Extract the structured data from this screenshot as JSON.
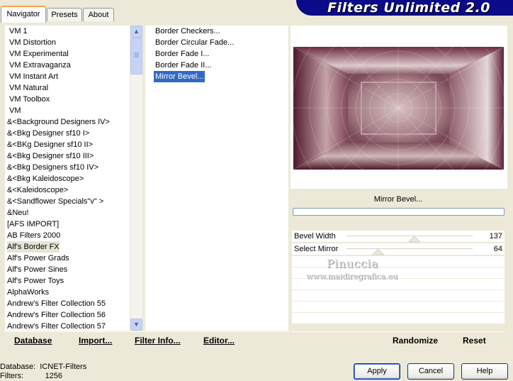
{
  "app": {
    "title": "Filters Unlimited 2.0"
  },
  "tabs": [
    {
      "label": "Navigator",
      "active": true
    },
    {
      "label": "Presets",
      "active": false
    },
    {
      "label": "About",
      "active": false
    }
  ],
  "categories": [
    "VM 1",
    "VM Distortion",
    "VM Experimental",
    "VM Extravaganza",
    "VM Instant Art",
    "VM Natural",
    "VM Toolbox",
    "VM",
    "&<Background Designers IV>",
    "&<Bkg Designer sf10 I>",
    "&<BKg Designer sf10 II>",
    "&<Bkg Designer sf10 III>",
    "&<Bkg Designers sf10 IV>",
    "&<Bkg Kaleidoscope>",
    "&<Kaleidoscope>",
    "&<Sandflower Specials\"v\" >",
    "&Neu!",
    "[AFS IMPORT]",
    "AB Filters 2000",
    "Alf's Border FX",
    "Alf's Power Grads",
    "Alf's Power Sines",
    "Alf's Power Toys",
    "AlphaWorks",
    "Andrew's Filter Collection 55",
    "Andrew's Filter Collection 56",
    "Andrew's Filter Collection 57"
  ],
  "selected_category": "Alf's Border FX",
  "filters": [
    "Border Checkers...",
    "Border Circular Fade...",
    "Border Fade I...",
    "Border Fade II...",
    "Mirror Bevel..."
  ],
  "selected_filter": "Mirror Bevel...",
  "preview": {
    "filter_name": "Mirror Bevel...",
    "colors": {
      "dark": "#5a1f30",
      "light": "#e8dcd8",
      "mid": "#a07a82"
    }
  },
  "params": [
    {
      "label": "Bevel Width",
      "value": "137",
      "level": 0.537
    },
    {
      "label": "Select Mirror",
      "value": "64",
      "level": 0.251
    }
  ],
  "watermark": {
    "name": "Pinuccia",
    "url": "www.maidiregrafica.eu"
  },
  "buttons": {
    "database": "Database",
    "import": "Import...",
    "filter_info": "Filter Info...",
    "editor": "Editor...",
    "randomize": "Randomize",
    "reset": "Reset",
    "apply": "Apply",
    "cancel": "Cancel",
    "help": "Help"
  },
  "status": {
    "database_label": "Database:",
    "database_value": "ICNET-Filters",
    "filters_label": "Filters:",
    "filters_value": "1256"
  },
  "colors": {
    "banner": "#0b0a88",
    "selection": "#316ac5",
    "tab_accent": "#f7a24b"
  }
}
